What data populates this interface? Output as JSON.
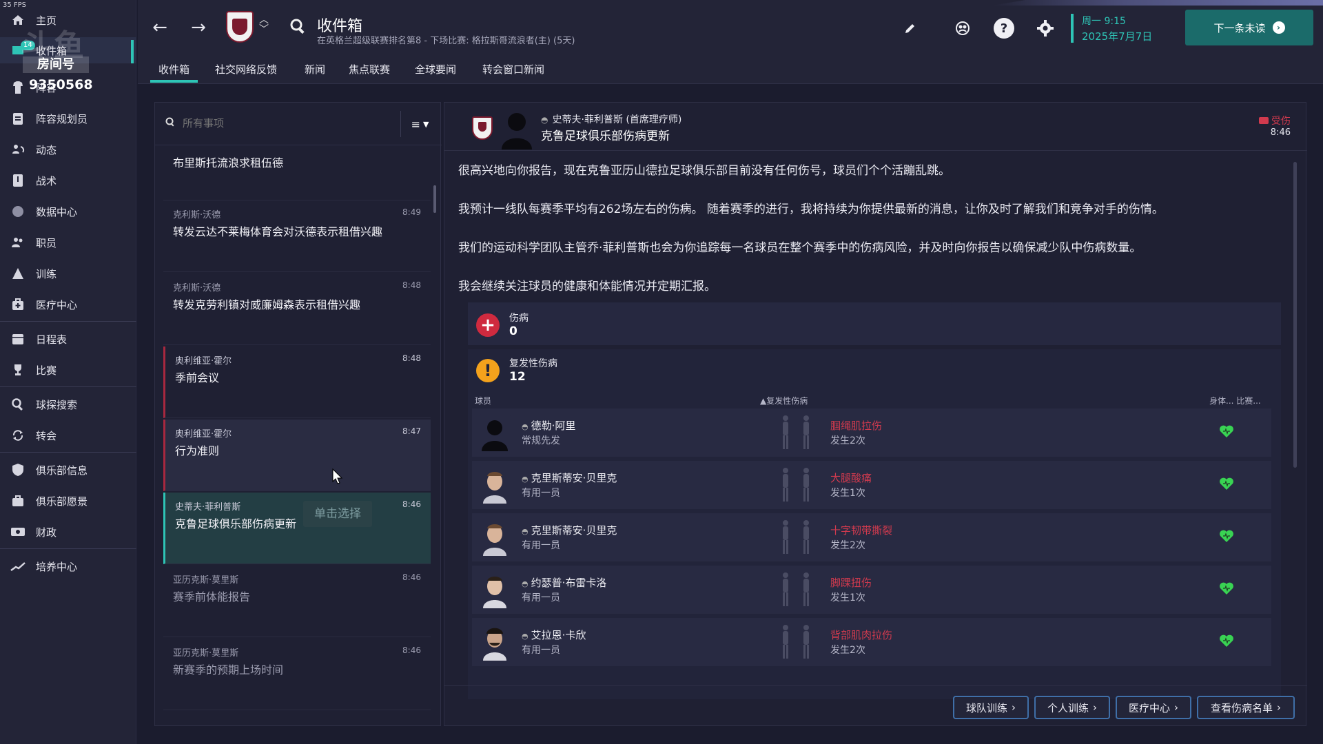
{
  "fps": "35 FPS",
  "overlay": {
    "logo_text": "斗鱼",
    "logo_sub": "房间号",
    "room_number": "9350568"
  },
  "sidebar": {
    "badge": "14",
    "items": [
      {
        "label": "主页",
        "icon": "home-icon"
      },
      {
        "label": "收件箱",
        "icon": "inbox-icon"
      },
      {
        "label": "阵容",
        "icon": "squad-icon"
      },
      {
        "label": "阵容规划员",
        "icon": "clipboard-icon"
      },
      {
        "label": "动态",
        "icon": "dynamics-icon"
      },
      {
        "label": "战术",
        "icon": "tactics-icon"
      },
      {
        "label": "数据中心",
        "icon": "data-hub-icon"
      },
      {
        "label": "职员",
        "icon": "staff-icon"
      },
      {
        "label": "训练",
        "icon": "training-icon"
      },
      {
        "label": "医疗中心",
        "icon": "medical-icon"
      },
      {
        "label": "日程表",
        "icon": "calendar-icon"
      },
      {
        "label": "比赛",
        "icon": "trophy-icon"
      },
      {
        "label": "球探搜索",
        "icon": "scouting-icon"
      },
      {
        "label": "转会",
        "icon": "transfer-icon"
      },
      {
        "label": "俱乐部信息",
        "icon": "shield-icon"
      },
      {
        "label": "俱乐部愿景",
        "icon": "vision-icon"
      },
      {
        "label": "财政",
        "icon": "finance-icon"
      },
      {
        "label": "培养中心",
        "icon": "development-icon"
      }
    ]
  },
  "header": {
    "title": "收件箱",
    "subtitle": "在英格兰超级联赛排名第8 - 下场比赛: 格拉斯哥流浪者(主) (5天)",
    "date_line1": "周一 9:15",
    "date_line2": "2025年7月7日",
    "next_unread": "下一条未读"
  },
  "tabs": [
    "收件箱",
    "社交网络反馈",
    "新闻",
    "焦点联赛",
    "全球要闻",
    "转会窗口新闻"
  ],
  "list": {
    "search_placeholder": "所有事项",
    "messages": [
      {
        "sender": "",
        "subject": "布里斯托流浪求租伍德",
        "time": ""
      },
      {
        "sender": "克利斯·沃德",
        "subject": "转发云达不莱梅体育会对沃德表示租借兴趣",
        "time": "8:49"
      },
      {
        "sender": "克利斯·沃德",
        "subject": "转发克劳利镇对威廉姆森表示租借兴趣",
        "time": "8:48"
      },
      {
        "sender": "奥利维亚·霍尔",
        "subject": "季前会议",
        "time": "8:48"
      },
      {
        "sender": "奥利维亚·霍尔",
        "subject": "行为准则",
        "time": "8:47"
      },
      {
        "sender": "史蒂夫·菲利普斯",
        "subject": "克鲁足球俱乐部伤病更新",
        "time": "8:46"
      },
      {
        "sender": "亚历克斯·莫里斯",
        "subject": "赛季前体能报告",
        "time": "8:46"
      },
      {
        "sender": "亚历克斯·莫里斯",
        "subject": "新赛季的预期上场时间",
        "time": "8:46"
      }
    ],
    "select_tip": "单击选择"
  },
  "detail": {
    "sender": "史蒂夫·菲利普斯 (首席理疗师)",
    "subject": "克鲁足球俱乐部伤病更新",
    "tag": "受伤",
    "time": "8:46",
    "paragraphs": [
      "很高兴地向你报告，现在克鲁亚历山德拉足球俱乐部目前没有任何伤号，球员们个个活蹦乱跳。",
      "我预计一线队每赛季平均有262场左右的伤病。 随着赛季的进行，我将持续为你提供最新的消息，让你及时了解我们和竞争对手的伤情。",
      "我们的运动科学团队主管乔·菲利普斯也会为你追踪每一名球员在整个赛季中的伤病风险，并及时向你报告以确保减少队中伤病数量。",
      "我会继续关注球员的健康和体能情况并定期汇报。"
    ],
    "injury_label": "伤病",
    "injury_count": "0",
    "recurring_label": "复发性伤病",
    "recurring_count": "12",
    "columns": {
      "player": "球员",
      "recurring": "▲复发性伤病",
      "fitness": "身体... 比赛..."
    },
    "players": [
      {
        "name": "德勒·阿里",
        "role": "常规先发",
        "injury": "腘绳肌拉伤",
        "occurrence": "发生2次"
      },
      {
        "name": "克里斯蒂安·贝里克",
        "role": "有用一员",
        "injury": "大腿酸痛",
        "occurrence": "发生1次"
      },
      {
        "name": "克里斯蒂安·贝里克",
        "role": "有用一员",
        "injury": "十字韧带撕裂",
        "occurrence": "发生2次"
      },
      {
        "name": "约瑟普·布雷卡洛",
        "role": "有用一员",
        "injury": "脚踝扭伤",
        "occurrence": "发生1次"
      },
      {
        "name": "艾拉恩·卡欣",
        "role": "有用一员",
        "injury": "背部肌肉拉伤",
        "occurrence": "发生2次"
      }
    ],
    "footer_buttons": [
      "球队训练",
      "个人训练",
      "医疗中心",
      "查看伤病名单"
    ]
  },
  "colors": {
    "accent": "#2ec4b6",
    "injury_red": "#d13a4e",
    "warning": "#f4a21c",
    "heart_green": "#39d353"
  }
}
